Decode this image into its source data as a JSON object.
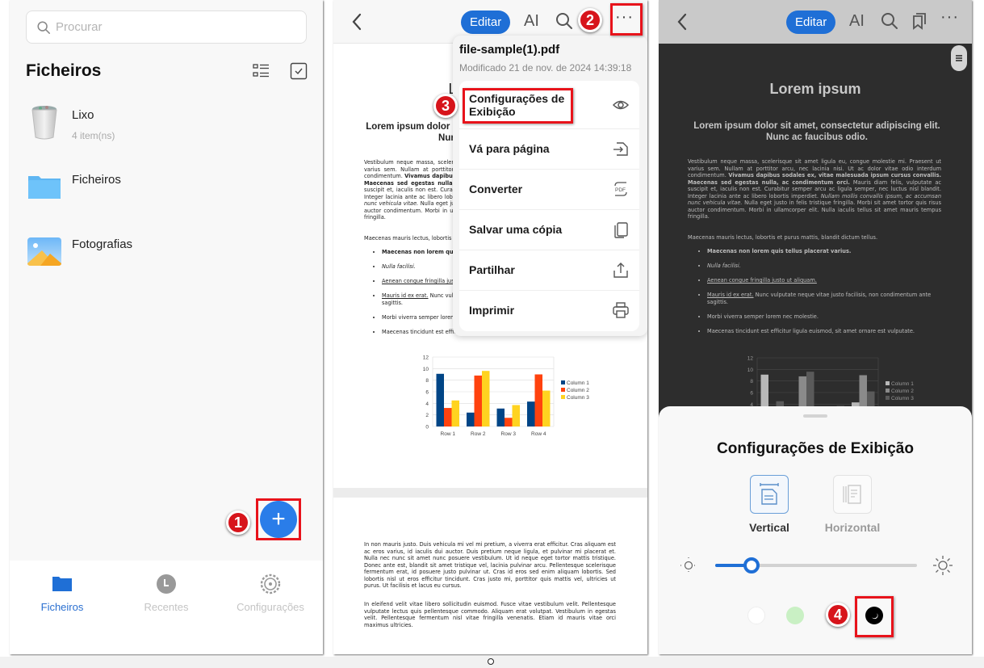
{
  "files_app": {
    "search_placeholder": "Procurar",
    "title": "Ficheiros",
    "items": [
      {
        "name": "Lixo",
        "sub": "4 item(ns)",
        "icon": "trash-icon"
      },
      {
        "name": "Ficheiros",
        "sub": "",
        "icon": "folder-icon"
      },
      {
        "name": "Fotografias",
        "sub": "",
        "icon": "photos-icon"
      }
    ],
    "fab_label": "+",
    "nav": [
      {
        "label": "Ficheiros",
        "icon": "folder-icon",
        "active": true
      },
      {
        "label": "Recentes",
        "icon": "clock-icon",
        "active": false
      },
      {
        "label": "Configurações",
        "icon": "gear-icon",
        "active": false
      }
    ],
    "accent": "#2a7de9"
  },
  "viewer": {
    "edit_label": "Editar",
    "ai_label": "AI",
    "more_label": "···",
    "menu": {
      "file_name": "file-sample(1).pdf",
      "modified": "Modificado 21 de nov. de 2024 14:39:18",
      "items": [
        {
          "label": "Configurações de Exibição",
          "icon": "eye-icon"
        },
        {
          "label": "Vá para página",
          "icon": "go-to-page-icon"
        },
        {
          "label": "Converter",
          "icon": "pdf-convert-icon"
        },
        {
          "label": "Salvar uma cópia",
          "icon": "copy-icon"
        },
        {
          "label": "Partilhar",
          "icon": "share-icon"
        },
        {
          "label": "Imprimir",
          "icon": "print-icon"
        }
      ]
    }
  },
  "document": {
    "title": "Lorem ipsum",
    "subtitle": "Lorem ipsum dolor sit amet, consectetur adipiscing elit. Nunc ac faucibus odio.",
    "para1_a": "Vestibulum neque massa, scelerisque sit amet ligula eu, congue molestie mi. Praesent ut varius sem. Nullam at porttitor arcu, nec lacinia nisi. Ut ac dolor vitae odio interdum condimentum. ",
    "para1_b": "Vivamus dapibus sodales ex, vitae malesuada ipsum cursus convallis. Maecenas sed egestas nulla, ac condimentum orci.",
    "para1_c": " Mauris diam felis, vulputate ac suscipit et, iaculis non est. Curabitur semper arcu ac ligula semper, nec luctus nisl blandit. Integer lacinia ante ac libero lobortis imperdiet. ",
    "para1_d": "Nullam mollis convallis ipsum, ac accumsan nunc vehicula vitae.",
    "para1_e": " Nulla eget justo in felis tristique fringilla. Morbi sit amet tortor quis risus auctor condimentum. Morbi in ullamcorper elit. Nulla iaculis tellus sit amet mauris tempus fringilla.",
    "para2": "Maecenas mauris lectus, lobortis et purus mattis, blandit dictum tellus.",
    "bullets": [
      "Maecenas non lorem quis tellus placerat varius.",
      "Nulla facilisi.",
      "Aenean congue fringilla justo ut aliquam.",
      "Mauris id ex erat.",
      "Morbi viverra semper lorem nec molestie.",
      "Maecenas tincidunt est efficitur ligula euismod, sit amet ornare est vulputate."
    ],
    "bullet4_tail": " Nunc vulputate neque vitae justo facilisis, non condimentum ante sagittis.",
    "page2_para1": "In non mauris justo. Duis vehicula mi vel mi pretium, a viverra erat efficitur. Cras aliquam est ac eros varius, id iaculis dui auctor. Duis pretium neque ligula, et pulvinar mi placerat et. Nulla nec nunc sit amet nunc posuere vestibulum. Ut id neque eget tortor mattis tristique. Donec ante est, blandit sit amet tristique vel, lacinia pulvinar arcu. Pellentesque scelerisque fermentum erat, id posuere justo pulvinar ut. Cras id eros sed enim aliquam lobortis. Sed lobortis nisl ut eros efficitur tincidunt. Cras justo mi, porttitor quis mattis vel, ultricies ut purus. Ut facilisis et lacus eu cursus.",
    "page2_para2": "In eleifend velit vitae libero sollicitudin euismod. Fusce vitae vestibulum velit. Pellentesque vulputate lectus quis pellentesque commodo. Aliquam erat volutpat. Vestibulum in egestas velit. Pellentesque fermentum nisl vitae fringilla venenatis. Etiam id mauris vitae orci maximus ultricies."
  },
  "chart_data": {
    "type": "bar",
    "categories": [
      "Row 1",
      "Row 2",
      "Row 3",
      "Row 4"
    ],
    "series": [
      {
        "name": "Column 1",
        "values": [
          9.1,
          2.4,
          3.1,
          4.3
        ],
        "color": "#004586"
      },
      {
        "name": "Column 2",
        "values": [
          3.2,
          8.8,
          1.5,
          9.0
        ],
        "color": "#ff420e"
      },
      {
        "name": "Column 3",
        "values": [
          4.5,
          9.6,
          3.7,
          6.2
        ],
        "color": "#ffd320"
      }
    ],
    "yticks": [
      "0",
      "2",
      "4",
      "6",
      "8",
      "10",
      "12"
    ],
    "ylim": [
      0,
      12
    ],
    "grid": true,
    "legend": "right",
    "title": "",
    "xlabel": "",
    "ylabel": ""
  },
  "display_settings": {
    "title": "Configurações de Exibição",
    "modes": [
      {
        "label": "Vertical",
        "selected": true
      },
      {
        "label": "Horizontal",
        "selected": false
      }
    ],
    "brightness": 0.18,
    "themes": [
      {
        "name": "white",
        "color": "#ffffff"
      },
      {
        "name": "green",
        "color": "#c9f0c4"
      },
      {
        "name": "dark",
        "color": "#000000",
        "selected": true
      }
    ]
  },
  "annotations": [
    "1",
    "2",
    "3",
    "4"
  ]
}
